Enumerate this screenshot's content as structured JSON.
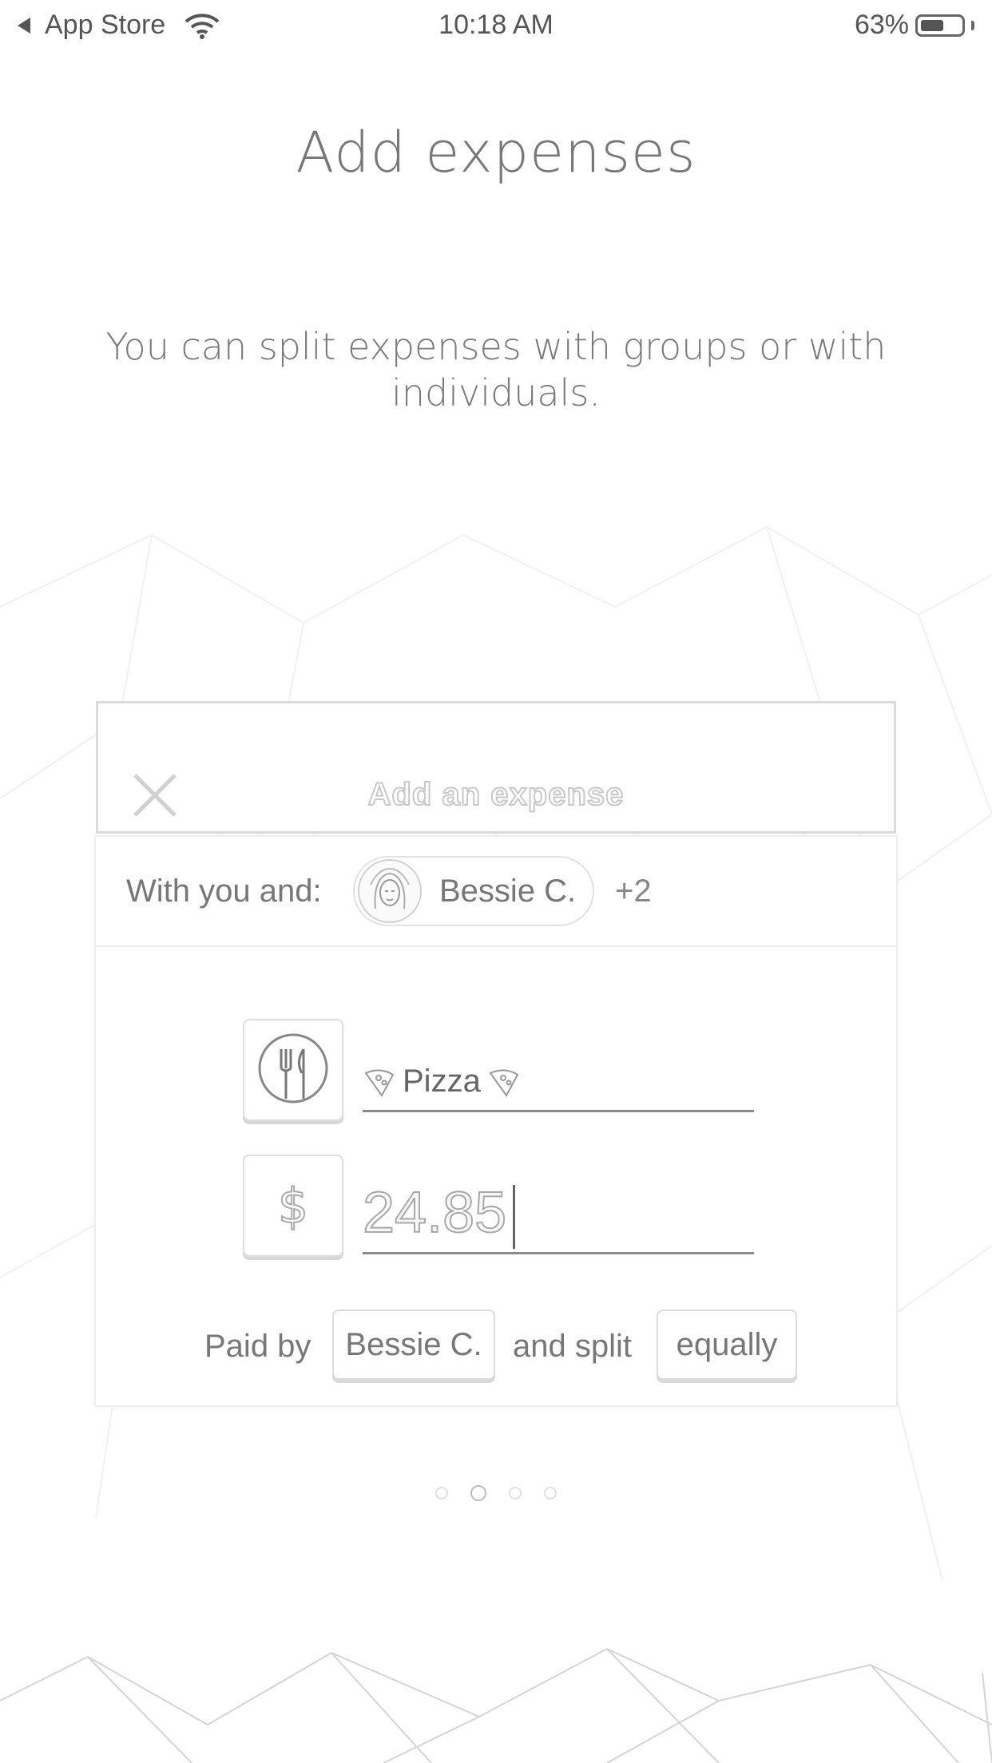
{
  "status_bar": {
    "back_app": "App Store",
    "time": "10:18 AM",
    "battery": "63%"
  },
  "onboarding": {
    "title": "Add expenses",
    "subtitle": "You can split expenses with groups or with individuals."
  },
  "expense_form": {
    "header_title": "Add an expense",
    "with_label": "With you and:",
    "person_name": "Bessie C.",
    "extra_count": "+2",
    "description": "Pizza",
    "currency_symbol": "$",
    "amount": "24.85",
    "paid_by_label": "Paid by",
    "payer": "Bessie C.",
    "and_split_label": "and split",
    "split_method": "equally"
  },
  "pager": {
    "count": 4,
    "active_index": 1
  }
}
